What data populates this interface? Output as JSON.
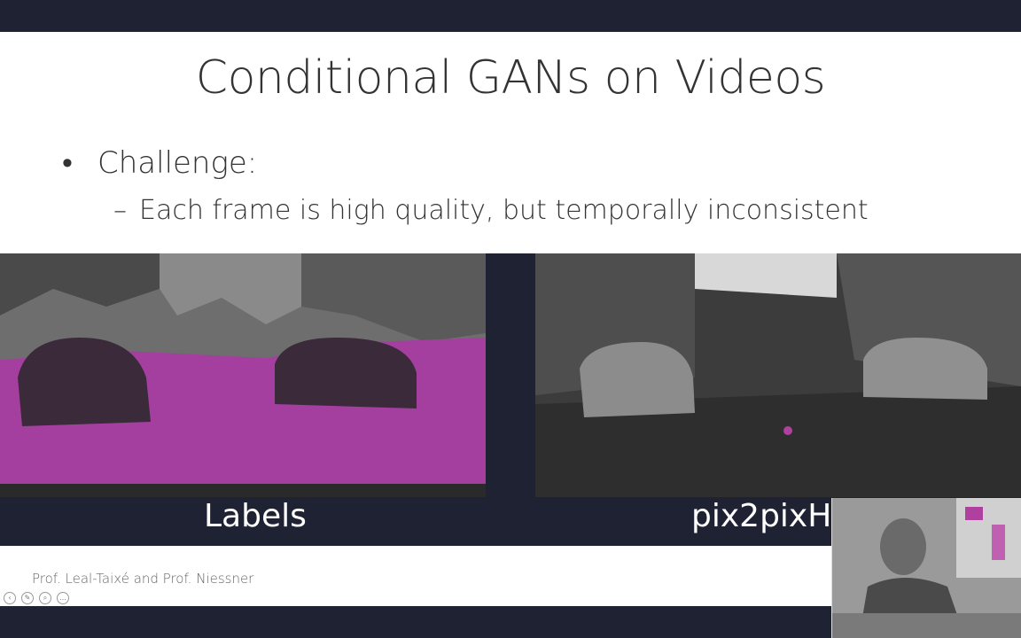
{
  "slide": {
    "title": "Conditional GANs on Videos",
    "bullets": [
      {
        "marker": "•",
        "text": "Challenge:"
      },
      {
        "marker": "–",
        "text": "Each frame is high quality, but temporally inconsistent"
      }
    ],
    "captions": {
      "left": "Labels",
      "right": "pix2pixH"
    },
    "footer": "Prof. Leal-Taixé and Prof. Niessner"
  },
  "controls": [
    "prev-icon",
    "pen-icon",
    "zoom-icon",
    "more-icon"
  ],
  "colors": {
    "frame": "#1e2233",
    "label_magenta": "#a43fa0",
    "label_car": "#3a2a3a"
  }
}
